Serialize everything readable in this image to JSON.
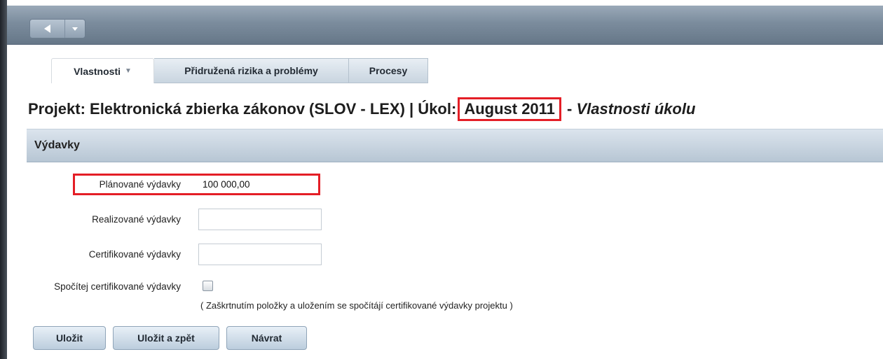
{
  "toolbar": {
    "back_icon": "triangle-left-icon",
    "menu_icon": "chevron-down-icon"
  },
  "tabs": [
    {
      "label": "Vlastnosti",
      "active": true,
      "has_dropdown": true
    },
    {
      "label": "Přidružená rizika a problémy",
      "active": false
    },
    {
      "label": "Procesy",
      "active": false
    }
  ],
  "title": {
    "prefix": "Projekt: Elektronická zbierka zákonov (SLOV - LEX) | Úkol:",
    "task": "August 2011",
    "dash": " - ",
    "suffix": "Vlastnosti úkolu"
  },
  "section": {
    "title": "Výdavky"
  },
  "fields": {
    "planned": {
      "label": "Plánované výdavky",
      "value": "100 000,00"
    },
    "realized": {
      "label": "Realizované výdavky",
      "value": ""
    },
    "certified": {
      "label": "Certifikované výdavky",
      "value": ""
    },
    "compute": {
      "label": "Spočítej certifikované výdavky",
      "checked": false,
      "note": "( Zaškrtnutím položky a uložením se spočítájí certifikované výdavky projektu )"
    }
  },
  "buttons": {
    "save": "Uložit",
    "save_back": "Uložit a zpět",
    "return": "Návrat"
  },
  "colors": {
    "highlight": "#e41e26",
    "toolbar": "#7b8c9d",
    "section_header": "#c6d3df"
  }
}
